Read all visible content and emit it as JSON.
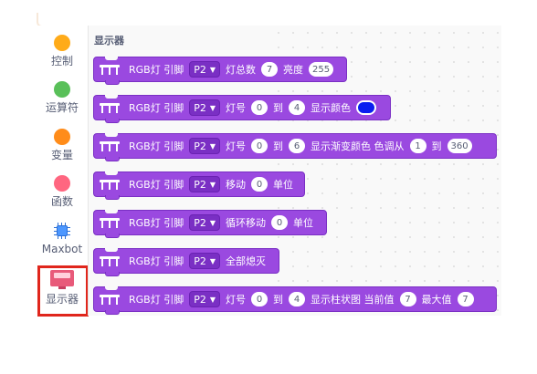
{
  "sidebar": {
    "items": [
      {
        "label": "控制",
        "color": "#ffab19"
      },
      {
        "label": "运算符",
        "color": "#59c059"
      },
      {
        "label": "变量",
        "color": "#ff8c1a"
      },
      {
        "label": "函数",
        "color": "#ff6680"
      },
      {
        "label": "Maxbot",
        "icon": "chip-icon"
      },
      {
        "label": "显示器",
        "icon": "display-icon",
        "selected": true
      }
    ]
  },
  "palette": {
    "heading": "显示器",
    "blocks": [
      {
        "text": "RGB灯 引脚",
        "pin": "P2",
        "a": "灯总数",
        "b": "7",
        "c": "亮度",
        "d": "255"
      },
      {
        "text": "RGB灯 引脚",
        "pin": "P2",
        "a": "灯号",
        "b": "0",
        "c": "到",
        "d": "4",
        "e": "显示颜色",
        "color": "#0a1ef0"
      },
      {
        "text": "RGB灯 引脚",
        "pin": "P2",
        "a": "灯号",
        "b": "0",
        "c": "到",
        "d": "6",
        "e": "显示渐变颜色 色调从",
        "f": "1",
        "g": "到",
        "h": "360"
      },
      {
        "text": "RGB灯 引脚",
        "pin": "P2",
        "a": "移动",
        "b": "0",
        "c": "单位"
      },
      {
        "text": "RGB灯 引脚",
        "pin": "P2",
        "a": "循环移动",
        "b": "0",
        "c": "单位"
      },
      {
        "text": "RGB灯 引脚",
        "pin": "P2",
        "a": "全部熄灭"
      },
      {
        "text": "RGB灯 引脚",
        "pin": "P2",
        "a": "灯号",
        "b": "0",
        "c": "到",
        "d": "4",
        "e": "显示柱状图 当前值",
        "f": "7",
        "g": "最大值",
        "h": "7"
      }
    ]
  },
  "colors": {
    "block": "#9a49e0",
    "block_border": "#7a2fc4",
    "selection": "#e0261c"
  }
}
